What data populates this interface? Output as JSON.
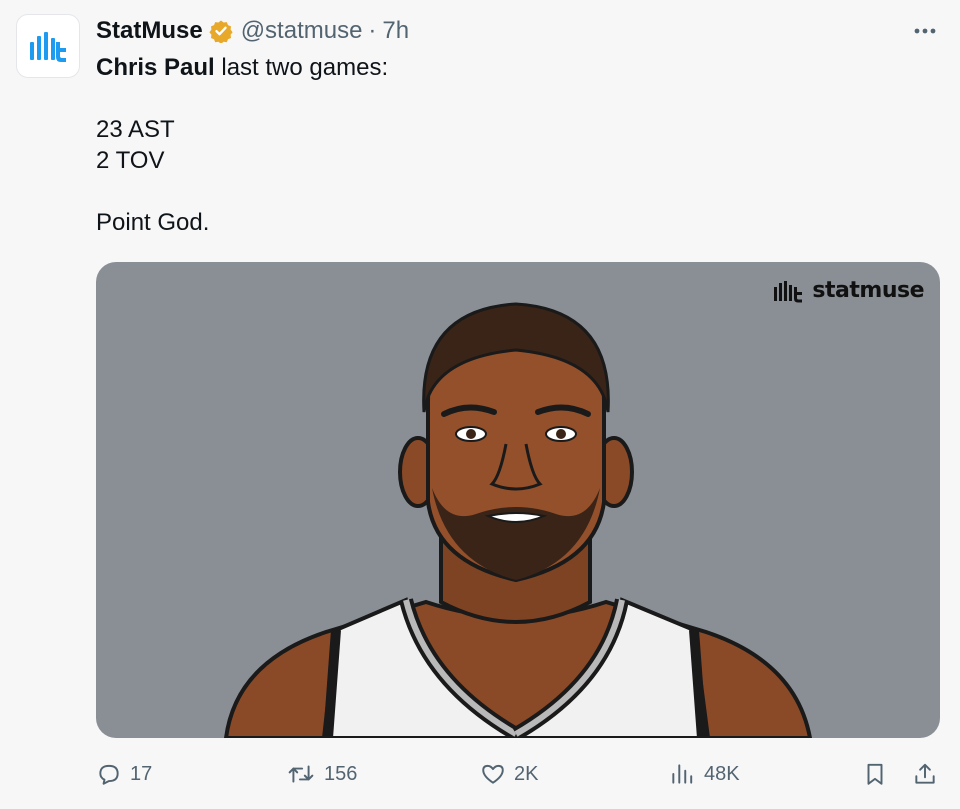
{
  "tweet": {
    "display_name": "StatMuse",
    "handle": "@statmuse",
    "separator": "·",
    "time": "7h",
    "verified_icon": "verified-badge-icon",
    "text": {
      "mention": "Chris Paul",
      "line1_rest": " last two games:",
      "line2": "23 AST",
      "line3": "2 TOV",
      "line4": "Point God."
    },
    "media": {
      "watermark": "statmuse",
      "subject": "illustrated basketball player portrait"
    }
  },
  "actions": {
    "reply": {
      "icon": "reply-icon",
      "count": "17"
    },
    "retweet": {
      "icon": "retweet-icon",
      "count": "156"
    },
    "like": {
      "icon": "heart-icon",
      "count": "2K"
    },
    "views": {
      "icon": "views-chart-icon",
      "count": "48K"
    },
    "bookmark": {
      "icon": "bookmark-icon"
    },
    "share": {
      "icon": "share-icon"
    }
  },
  "colors": {
    "brand": "#1d9bf0",
    "verified": "#e8a92a",
    "muted": "#536471",
    "media_bg": "#8a8f95"
  }
}
